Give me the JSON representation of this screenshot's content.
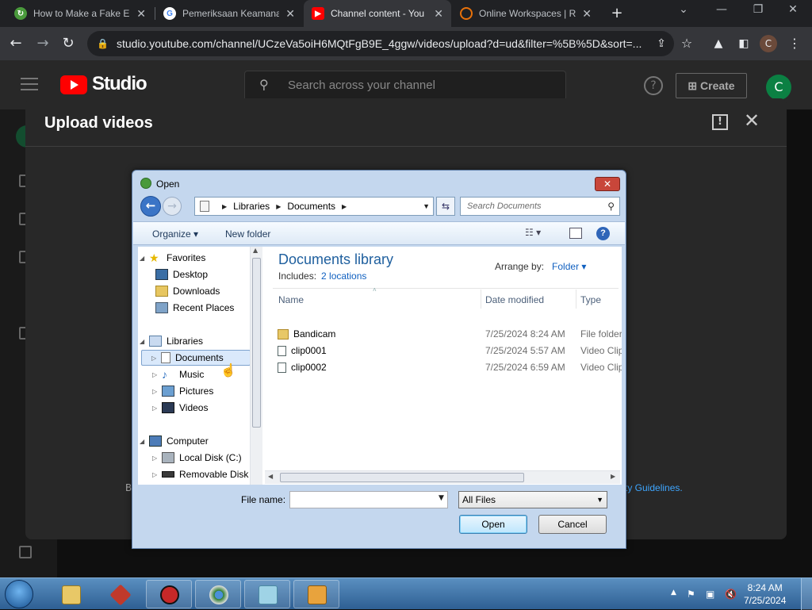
{
  "browser": {
    "tabs": [
      {
        "title": "How to Make a Fake E",
        "active": false
      },
      {
        "title": "Pemeriksaan Keamana",
        "active": false
      },
      {
        "title": "Channel content - You",
        "active": true
      },
      {
        "title": "Online Workspaces | R",
        "active": false
      }
    ],
    "url": "studio.youtube.com/channel/UCzeVa5oiH6MQtFgB9E_4ggw/videos/upload?d=ud&filter=%5B%5D&sort=...",
    "profile_initial": "C"
  },
  "studio": {
    "logo_text": "Studio",
    "search_placeholder": "Search across your channel",
    "create_label": "Create",
    "avatar_initial": "C"
  },
  "upload_modal": {
    "title": "Upload videos",
    "footer_prefix": "B",
    "footer_link": "ty Guidelines."
  },
  "open_dialog": {
    "title": "Open",
    "breadcrumb": [
      "Libraries",
      "Documents"
    ],
    "search_placeholder": "Search Documents",
    "organize_label": "Organize",
    "new_folder_label": "New folder",
    "nav": {
      "favorites_label": "Favorites",
      "favorites": [
        "Desktop",
        "Downloads",
        "Recent Places"
      ],
      "libraries_label": "Libraries",
      "libraries": [
        "Documents",
        "Music",
        "Pictures",
        "Videos"
      ],
      "computer_label": "Computer",
      "drives": [
        "Local Disk (C:)",
        "Removable Disk ("
      ]
    },
    "library": {
      "title": "Documents library",
      "includes_label": "Includes:",
      "includes_link": "2 locations",
      "arrange_label": "Arrange by:",
      "arrange_value": "Folder"
    },
    "columns": {
      "name": "Name",
      "date": "Date modified",
      "type": "Type"
    },
    "files": [
      {
        "name": "Bandicam",
        "date": "7/25/2024 8:24 AM",
        "type": "File folder",
        "kind": "folder"
      },
      {
        "name": "clip0001",
        "date": "7/25/2024 5:57 AM",
        "type": "Video Clip",
        "kind": "video"
      },
      {
        "name": "clip0002",
        "date": "7/25/2024 6:59 AM",
        "type": "Video Clip",
        "kind": "video"
      }
    ],
    "file_name_label": "File name:",
    "file_name_value": "",
    "filter_value": "All Files",
    "open_label": "Open",
    "cancel_label": "Cancel"
  },
  "taskbar": {
    "time": "8:24 AM",
    "date": "7/25/2024"
  },
  "colors": {
    "youtube_red": "#ff0000",
    "studio_dark": "#282828",
    "link_blue": "#3ea6ff",
    "win_accent": "#1e5f9e"
  }
}
